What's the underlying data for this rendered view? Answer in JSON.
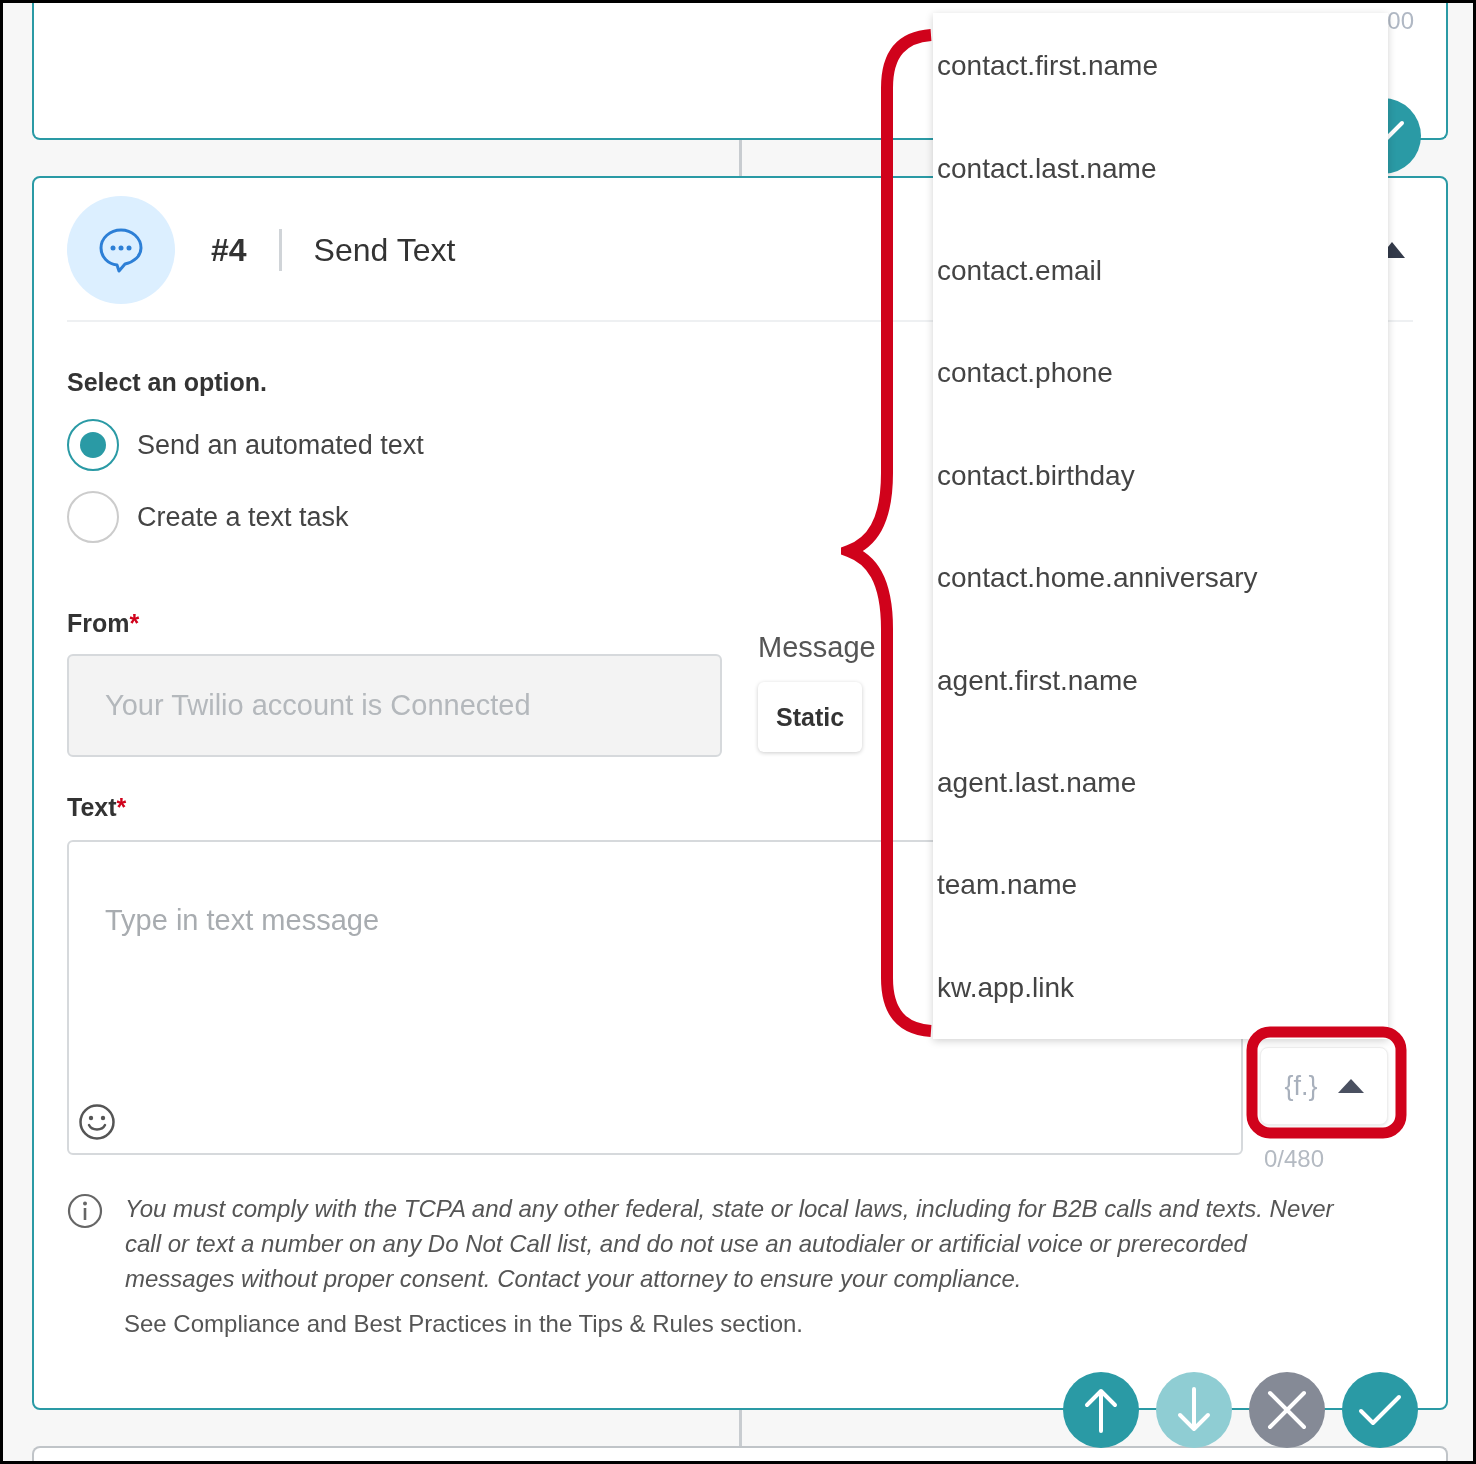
{
  "previous_step": {
    "counter": "00"
  },
  "step": {
    "number": "#4",
    "title": "Send Text",
    "expanded": true
  },
  "option_prompt": "Select an option.",
  "options": [
    {
      "label": "Send an automated text",
      "selected": true
    },
    {
      "label": "Create a text task",
      "selected": false
    }
  ],
  "from": {
    "label": "From",
    "required_mark": "*",
    "placeholder": "Your Twilio account is Connected"
  },
  "message_type": {
    "label": "Message",
    "options": [
      {
        "label": "Static",
        "selected": true
      }
    ]
  },
  "text": {
    "label": "Text",
    "required_mark": "*",
    "placeholder": "Type in text message",
    "counter": "0/480"
  },
  "field_picker": {
    "label": "{f.}",
    "open": true,
    "items": [
      "contact.first.name",
      "contact.last.name",
      "contact.email",
      "contact.phone",
      "contact.birthday",
      "contact.home.anniversary",
      "agent.first.name",
      "agent.last.name",
      "team.name",
      "kw.app.link"
    ]
  },
  "notice": {
    "text": "You must comply with the TCPA and any other federal, state or local laws, including for B2B calls and texts. Never call or text a number on any Do Not Call list, and do not use an autodialer or artificial voice or prerecorded messages without proper consent. Contact your attorney to ensure your compliance.",
    "tips": "See Compliance and Best Practices in the Tips & Rules section."
  },
  "actions": [
    {
      "kind": "up",
      "disabled": false
    },
    {
      "kind": "down",
      "disabled": true
    },
    {
      "kind": "cancel",
      "disabled": false
    },
    {
      "kind": "confirm",
      "disabled": false
    }
  ]
}
